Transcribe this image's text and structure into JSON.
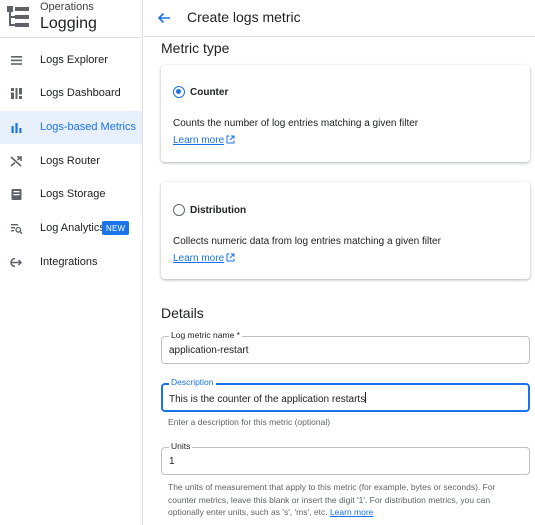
{
  "brand": {
    "subtitle": "Operations",
    "title": "Logging"
  },
  "sidebar": {
    "items": [
      {
        "label": "Logs Explorer",
        "icon": "list-icon"
      },
      {
        "label": "Logs Dashboard",
        "icon": "dashboard-icon"
      },
      {
        "label": "Logs-based Metrics",
        "icon": "bar-chart-icon",
        "active": true
      },
      {
        "label": "Logs Router",
        "icon": "shuffle-icon"
      },
      {
        "label": "Logs Storage",
        "icon": "storage-icon"
      },
      {
        "label": "Log Analytics",
        "icon": "analytics-icon",
        "badge": "NEW"
      },
      {
        "label": "Integrations",
        "icon": "integrations-icon"
      }
    ]
  },
  "header": {
    "title": "Create logs metric"
  },
  "metric_type": {
    "heading": "Metric type",
    "options": [
      {
        "label": "Counter",
        "description": "Counts the number of log entries matching a given filter",
        "link": "Learn more",
        "selected": true
      },
      {
        "label": "Distribution",
        "description": "Collects numeric data from log entries matching a given filter",
        "link": "Learn more",
        "selected": false
      }
    ]
  },
  "details": {
    "heading": "Details",
    "name": {
      "label": "Log metric name *",
      "value": "application-restart"
    },
    "description": {
      "label": "Description",
      "value": "This is the counter of the application restarts",
      "helper": "Enter a description for this metric (optional)"
    },
    "units": {
      "label": "Units",
      "value": "1",
      "helper_line1": "The units of measurement that apply to this metric (for example, bytes or seconds). For",
      "helper_line2": "counter metrics, leave this blank or insert the digit '1'. For distribution metrics, you can",
      "helper_line3": "optionally enter units, such as 's', 'ms', etc.",
      "helper_link": "Learn more"
    }
  },
  "colors": {
    "accent": "#1a73e8",
    "active_bg": "#e8f0fe",
    "border": "#dadce0"
  }
}
